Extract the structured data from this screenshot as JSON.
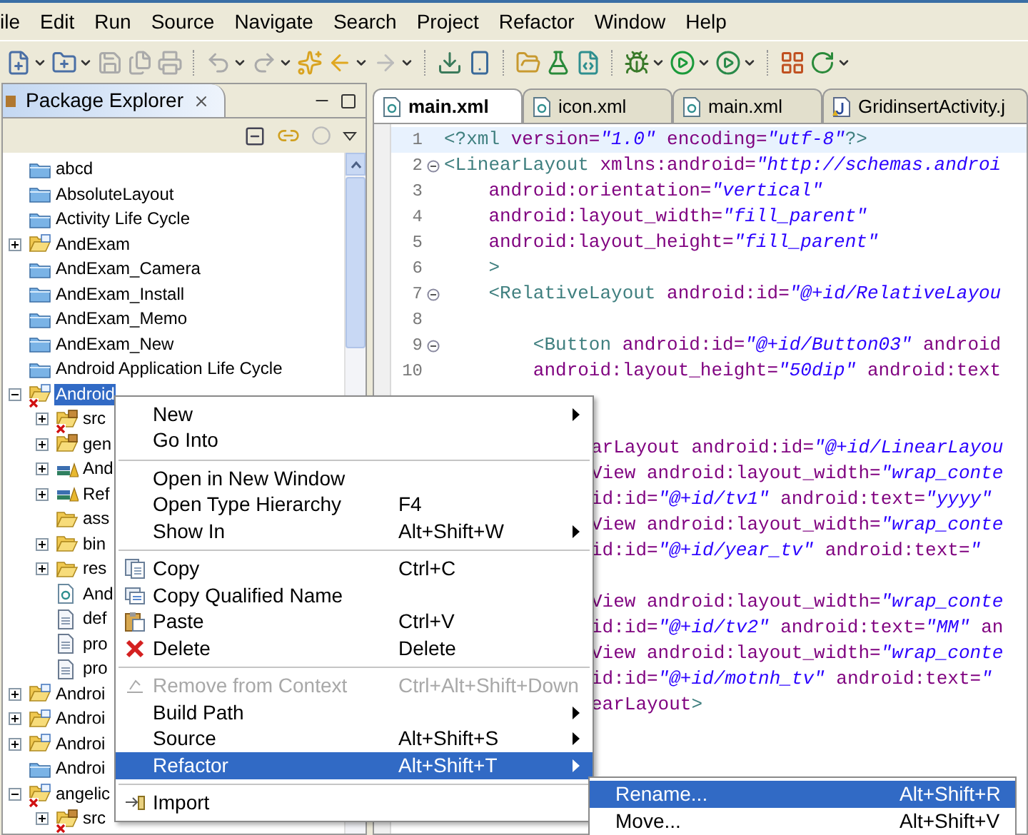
{
  "menu_bar": [
    "ile",
    "Edit",
    "Run",
    "Source",
    "Navigate",
    "Search",
    "Project",
    "Refactor",
    "Window",
    "Help"
  ],
  "package_explorer": {
    "title": "Package Explorer",
    "tree": [
      {
        "label": "abcd",
        "kind": "closed_project",
        "error": false,
        "selected": false
      },
      {
        "label": "AbsoluteLayout",
        "kind": "closed_project",
        "error": false,
        "selected": false
      },
      {
        "label": "Activity Life Cycle",
        "kind": "closed_project",
        "error": false,
        "selected": false
      },
      {
        "label": "AndExam",
        "kind": "project",
        "error": false,
        "selected": false,
        "expanded": false
      },
      {
        "label": "AndExam_Camera",
        "kind": "closed_project",
        "error": false,
        "selected": false
      },
      {
        "label": "AndExam_Install",
        "kind": "closed_project",
        "error": false,
        "selected": false
      },
      {
        "label": "AndExam_Memo",
        "kind": "closed_project",
        "error": false,
        "selected": false
      },
      {
        "label": "AndExam_New",
        "kind": "closed_project",
        "error": false,
        "selected": false
      },
      {
        "label": "Android Application Life Cycle",
        "kind": "closed_project",
        "error": false,
        "selected": false
      },
      {
        "label": "Android",
        "kind": "project",
        "error": true,
        "selected": true,
        "expanded": true,
        "children": [
          {
            "label": "src",
            "kind": "source_folder",
            "error": true,
            "selected": false,
            "expanded": false
          },
          {
            "label": "gen",
            "kind": "source_folder",
            "error": false,
            "selected": false,
            "expanded": false
          },
          {
            "label": "And",
            "kind": "library",
            "error": false,
            "selected": false,
            "expanded": false
          },
          {
            "label": "Ref",
            "kind": "library",
            "error": false,
            "selected": false,
            "expanded": false
          },
          {
            "label": "ass",
            "kind": "folder",
            "error": false,
            "selected": false
          },
          {
            "label": "bin",
            "kind": "folder",
            "error": false,
            "selected": false,
            "expanded": false
          },
          {
            "label": "res",
            "kind": "folder",
            "error": false,
            "selected": false,
            "expanded": false
          },
          {
            "label": "And",
            "kind": "xml_file",
            "error": false,
            "selected": false
          },
          {
            "label": "def",
            "kind": "file",
            "error": false,
            "selected": false
          },
          {
            "label": "pro",
            "kind": "file",
            "error": false,
            "selected": false
          },
          {
            "label": "pro",
            "kind": "file",
            "error": false,
            "selected": false
          }
        ]
      },
      {
        "label": "Androi",
        "kind": "project",
        "error": false,
        "selected": false,
        "expanded": false
      },
      {
        "label": "Androi",
        "kind": "project",
        "error": false,
        "selected": false,
        "expanded": false
      },
      {
        "label": "Androi",
        "kind": "project",
        "error": false,
        "selected": false,
        "expanded": false
      },
      {
        "label": "Androi",
        "kind": "closed_project",
        "error": false,
        "selected": false
      },
      {
        "label": "angelic",
        "kind": "project",
        "error": true,
        "selected": false,
        "expanded": true,
        "children": [
          {
            "label": "src",
            "kind": "source_folder",
            "error": true,
            "selected": false,
            "expanded": false
          }
        ]
      }
    ]
  },
  "editor": {
    "tabs": [
      {
        "label": "main.xml",
        "kind": "xml",
        "selected": true
      },
      {
        "label": "icon.xml",
        "kind": "xml",
        "selected": false
      },
      {
        "label": "main.xml",
        "kind": "xml",
        "selected": false
      },
      {
        "label": "GridinsertActivity.j",
        "kind": "java",
        "selected": false
      }
    ],
    "lines": [
      {
        "number": "1",
        "code": "<?xml version=\"1.0\" encoding=\"utf-8\"?>",
        "current": true,
        "foldable": false
      },
      {
        "number": "2",
        "code": "<LinearLayout xmlns:android=\"http://schemas.androi",
        "current": false,
        "foldable": true
      },
      {
        "number": "3",
        "code": "    android:orientation=\"vertical\"",
        "current": false,
        "foldable": false
      },
      {
        "number": "4",
        "code": "    android:layout_width=\"fill_parent\"",
        "current": false,
        "foldable": false
      },
      {
        "number": "5",
        "code": "    android:layout_height=\"fill_parent\"",
        "current": false,
        "foldable": false
      },
      {
        "number": "6",
        "code": "    >",
        "current": false,
        "foldable": false
      },
      {
        "number": "7",
        "code": "    <RelativeLayout android:id=\"@+id/RelativeLayou",
        "current": false,
        "foldable": true
      },
      {
        "number": "8",
        "current": false,
        "foldable": false
      },
      {
        "number": "9",
        "code": "        <Button android:id=\"@+id/Button03\" android",
        "current": false,
        "foldable": true
      },
      {
        "number": "10",
        "code": "        android:layout_height=\"50dip\" android:text",
        "current": false,
        "foldable": false
      }
    ],
    "covered_blocks": [
      [
        "arLayout android:id=\"@+id/LinearLayou",
        "View android:layout_width=\"wrap_conte",
        "id:id=\"@+id/tv1\" android:text=\"yyyy\"",
        "View android:layout_width=\"wrap_conte",
        "id:id=\"@+id/year_tv\" android:text=\""
      ],
      [
        "View android:layout_width=\"wrap_conte",
        "id:id=\"@+id/tv2\" android:text=\"MM\" an",
        "View android:layout_width=\"wrap_conte",
        "id:id=\"@+id/motnh_tv\" android:text=\"",
        "earLayout>"
      ]
    ]
  },
  "context_menu": {
    "items": [
      {
        "kind": "plain",
        "label": "New",
        "submenu": true,
        "disabled": false,
        "selected": false
      },
      {
        "kind": "plain",
        "label": "Go Into",
        "submenu": false,
        "disabled": false,
        "selected": false
      },
      {
        "kind": "separator"
      },
      {
        "kind": "plain",
        "label": "Open in New Window",
        "submenu": false,
        "disabled": false,
        "selected": false
      },
      {
        "kind": "plain",
        "label": "Open Type Hierarchy",
        "shortcut": "F4",
        "submenu": false,
        "disabled": false,
        "selected": false
      },
      {
        "kind": "plain",
        "label": "Show In",
        "shortcut": "Alt+Shift+W",
        "submenu": true,
        "disabled": false,
        "selected": false
      },
      {
        "kind": "separator"
      },
      {
        "kind": "copy",
        "label": "Copy",
        "shortcut": "Ctrl+C",
        "submenu": false,
        "disabled": false,
        "selected": false
      },
      {
        "kind": "copy_name",
        "label": "Copy Qualified Name",
        "submenu": false,
        "disabled": false,
        "selected": false
      },
      {
        "kind": "paste",
        "label": "Paste",
        "shortcut": "Ctrl+V",
        "submenu": false,
        "disabled": false,
        "selected": false
      },
      {
        "kind": "delete",
        "label": "Delete",
        "shortcut": "Delete",
        "submenu": false,
        "disabled": false,
        "selected": false
      },
      {
        "kind": "separator"
      },
      {
        "kind": "remove",
        "label": "Remove from Context",
        "shortcut": "Ctrl+Alt+Shift+Down",
        "submenu": false,
        "disabled": true,
        "selected": false
      },
      {
        "kind": "plain",
        "label": "Build Path",
        "submenu": true,
        "disabled": false,
        "selected": false
      },
      {
        "kind": "plain",
        "label": "Source",
        "shortcut": "Alt+Shift+S",
        "submenu": true,
        "disabled": false,
        "selected": false
      },
      {
        "kind": "plain",
        "label": "Refactor",
        "shortcut": "Alt+Shift+T",
        "submenu": true,
        "disabled": false,
        "selected": true
      },
      {
        "kind": "separator"
      },
      {
        "kind": "import",
        "label": "Import",
        "submenu": false,
        "disabled": false,
        "selected": false
      }
    ]
  },
  "submenu": {
    "items": [
      {
        "label": "Rename...",
        "shortcut": "Alt+Shift+R",
        "selected": true
      },
      {
        "label": "Move...",
        "shortcut": "Alt+Shift+V",
        "selected": false
      }
    ]
  }
}
